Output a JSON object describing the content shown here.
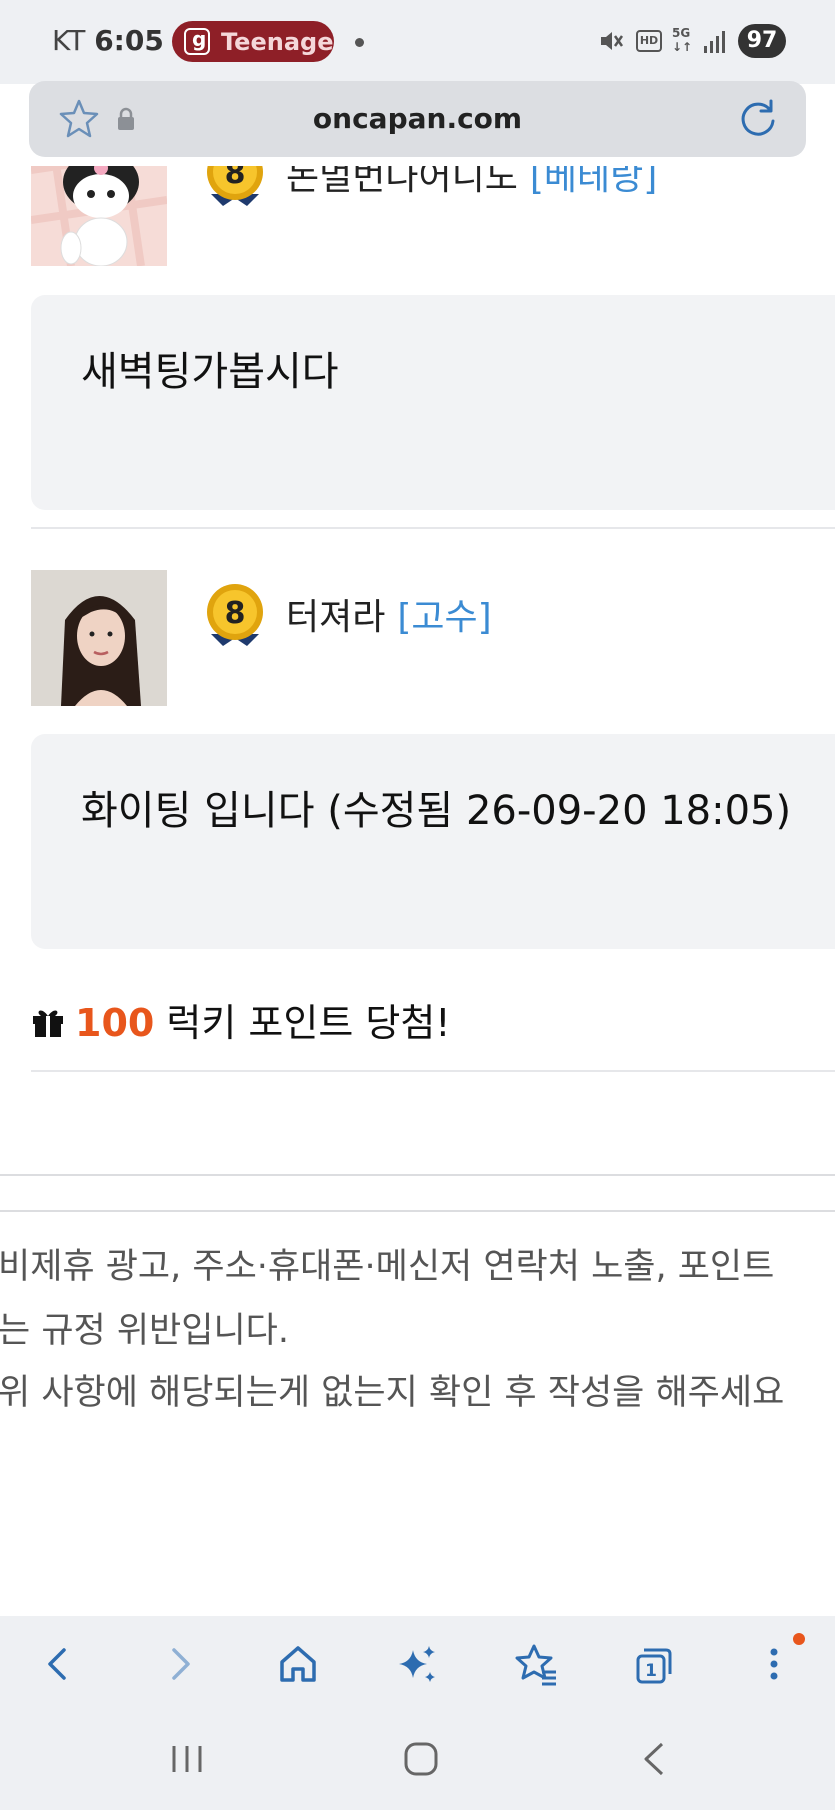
{
  "status_bar": {
    "carrier": "KT",
    "time": "6:05",
    "notification": "Teenage",
    "battery": "97"
  },
  "url_bar": {
    "domain": "oncapan.com"
  },
  "comments": [
    {
      "nickname": "논멀번나어니도",
      "rank": "[베테랑]",
      "level": "8",
      "body": "새벽팅가봅시다"
    },
    {
      "nickname": "터져라",
      "rank": "[고수]",
      "level": "8",
      "body": "화이팅 입니다 (수정됨 26-09-20 18:05)"
    }
  ],
  "lucky": {
    "points": "100",
    "text": "럭키 포인트 당첨!"
  },
  "notice": {
    "line1": "비제휴 광고, 주소·휴대폰·메신저 연락처 노출, 포인트",
    "line2": "는 규정 위반입니다.",
    "line3": "위 사항에 해당되는게 없는지 확인 후 작성을 해주세요"
  },
  "toolbar": {
    "tab_count": "1"
  },
  "colors": {
    "accent_orange": "#e8561c",
    "rank_blue": "#3b8bd3",
    "pill_red": "#8e1f27",
    "bubble_bg": "#f2f3f5"
  },
  "icons": {
    "toolbar": [
      "back-icon",
      "forward-icon",
      "home-icon",
      "ai-sparkle-icon",
      "bookmarks-icon",
      "tabs-icon",
      "menu-icon"
    ],
    "navbar": [
      "recent-apps-icon",
      "home-nav-icon",
      "back-nav-icon"
    ]
  }
}
